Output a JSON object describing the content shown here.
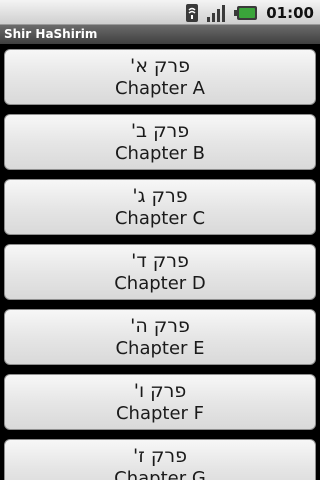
{
  "status_bar": {
    "time": "01:00",
    "icons": [
      "sync-icon",
      "signal-icon",
      "battery-icon"
    ]
  },
  "app": {
    "title": "Shir HaShirim"
  },
  "chapters": [
    {
      "hebrew": "פרק א'",
      "english": "Chapter A"
    },
    {
      "hebrew": "פרק ב'",
      "english": "Chapter B"
    },
    {
      "hebrew": "פרק ג'",
      "english": "Chapter C"
    },
    {
      "hebrew": "פרק ד'",
      "english": "Chapter D"
    },
    {
      "hebrew": "פרק ה'",
      "english": "Chapter E"
    },
    {
      "hebrew": "פרק ו'",
      "english": "Chapter F"
    },
    {
      "hebrew": "פרק ז'",
      "english": "Chapter G"
    }
  ],
  "colors": {
    "status_bar": "#e3e3e3",
    "title_bar": "#555555",
    "background": "#000000",
    "button": "#e6e6e6",
    "battery": "#3aa53a"
  }
}
